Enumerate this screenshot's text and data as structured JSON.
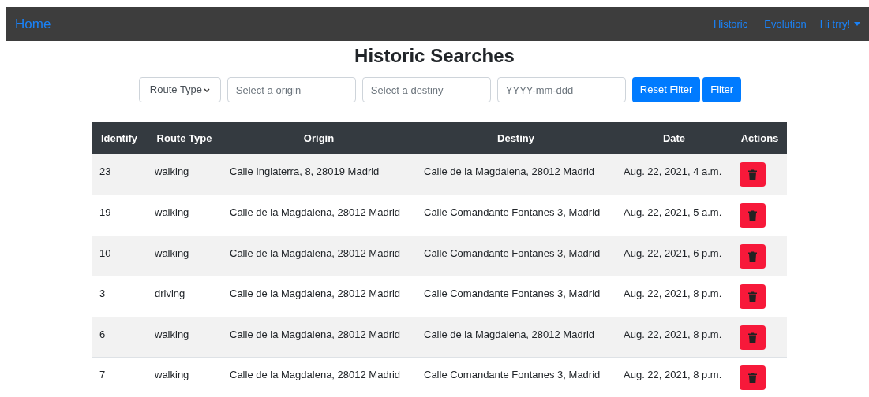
{
  "navbar": {
    "brand": "Home",
    "links": [
      "Historic",
      "Evolution"
    ],
    "user_menu": "Hi trry!"
  },
  "title": "Historic Searches",
  "filters": {
    "route_type": "Route Type",
    "origin": {
      "placeholder": "Select a origin"
    },
    "destiny": {
      "placeholder": "Select a destiny"
    },
    "date": {
      "placeholder": "YYYY-mm-ddd"
    },
    "buttons": [
      "Reset Filter",
      "Filter"
    ]
  },
  "table": {
    "columns": [
      "Identify",
      "Route Type",
      "Origin",
      "Destiny",
      "Date",
      "Actions"
    ],
    "rows": [
      {
        "identify": "23",
        "route_type": "walking",
        "origin": "Calle Inglaterra, 8, 28019 Madrid",
        "destiny": "Calle de la Magdalena, 28012 Madrid",
        "date": "Aug. 22, 2021, 4 a.m."
      },
      {
        "identify": "19",
        "route_type": "walking",
        "origin": "Calle de la Magdalena, 28012 Madrid",
        "destiny": "Calle Comandante Fontanes 3, Madrid",
        "date": "Aug. 22, 2021, 5 a.m."
      },
      {
        "identify": "10",
        "route_type": "walking",
        "origin": "Calle de la Magdalena, 28012 Madrid",
        "destiny": "Calle Comandante Fontanes 3, Madrid",
        "date": "Aug. 22, 2021, 6 p.m."
      },
      {
        "identify": "3",
        "route_type": "driving",
        "origin": "Calle de la Magdalena, 28012 Madrid",
        "destiny": "Calle Comandante Fontanes 3, Madrid",
        "date": "Aug. 22, 2021, 8 p.m."
      },
      {
        "identify": "6",
        "route_type": "walking",
        "origin": "Calle de la Magdalena, 28012 Madrid",
        "destiny": "Calle de la Magdalena, 28012 Madrid",
        "date": "Aug. 22, 2021, 8 p.m."
      },
      {
        "identify": "7",
        "route_type": "walking",
        "origin": "Calle de la Magdalena, 28012 Madrid",
        "destiny": "Calle Comandante Fontanes 3, Madrid",
        "date": "Aug. 22, 2021, 8 p.m."
      }
    ]
  }
}
